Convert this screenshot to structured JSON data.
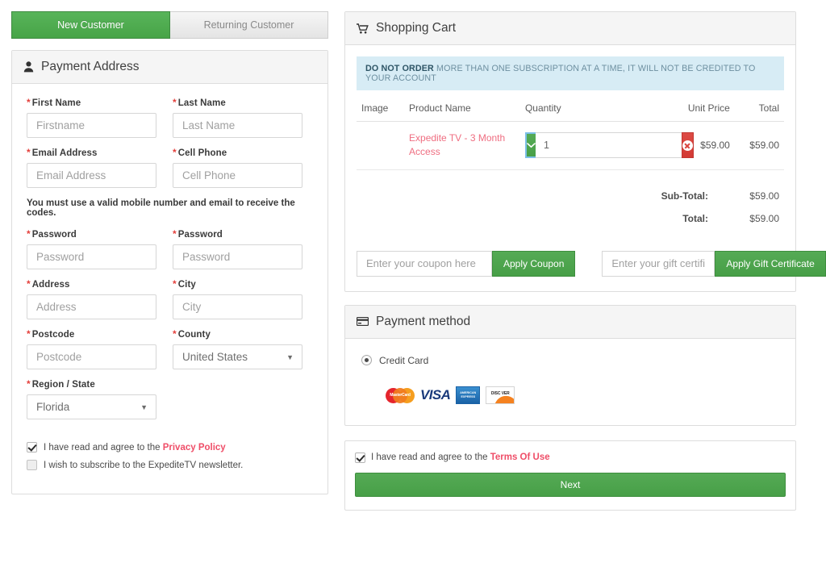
{
  "tabs": {
    "new_customer": "New Customer",
    "returning_customer": "Returning Customer"
  },
  "payment_address": {
    "title": "Payment Address",
    "icon": "user-icon",
    "required_marker": "*",
    "helper_text": "You must use a valid mobile number and email to receive the codes.",
    "fields": [
      {
        "label": "First Name",
        "placeholder": "Firstname",
        "value": "",
        "type": "text"
      },
      {
        "label": "Last Name",
        "placeholder": "Last Name",
        "value": "",
        "type": "text"
      },
      {
        "label": "Email Address",
        "placeholder": "Email Address",
        "value": "",
        "type": "text"
      },
      {
        "label": "Cell Phone",
        "placeholder": "Cell Phone",
        "value": "",
        "type": "text"
      },
      {
        "label": "Password",
        "placeholder": "Password",
        "value": "",
        "type": "password"
      },
      {
        "label": "Password",
        "placeholder": "Password",
        "value": "",
        "type": "password"
      },
      {
        "label": "Address",
        "placeholder": "Address",
        "value": "",
        "type": "text"
      },
      {
        "label": "City",
        "placeholder": "City",
        "value": "",
        "type": "text"
      },
      {
        "label": "Postcode",
        "placeholder": "Postcode",
        "value": "",
        "type": "text"
      },
      {
        "label": "County",
        "value": "United States",
        "type": "select"
      },
      {
        "label": "Region / State",
        "value": "Florida",
        "type": "select"
      }
    ],
    "consents": [
      {
        "text_before": "I have read and agree to the ",
        "link": "Privacy Policy",
        "checked": true
      },
      {
        "text_before": "I wish to subscribe to the ExpediteTV newsletter.",
        "link": "",
        "checked": false
      }
    ]
  },
  "cart": {
    "title": "Shopping Cart",
    "icon": "cart-icon",
    "alert_bold": "DO NOT ORDER",
    "alert_rest": " MORE THAN ONE SUBSCRIPTION AT A TIME, IT WILL NOT BE CREDITED TO YOUR ACCOUNT",
    "columns": [
      "Image",
      "Product Name",
      "Quantity",
      "Unit Price",
      "Total"
    ],
    "items": [
      {
        "product_name": "Expedite TV - 3 Month Access",
        "quantity": "1",
        "unit_price": "$59.00",
        "total": "$59.00",
        "decrement_icon": "chevron-down-icon",
        "remove_icon": "remove-circle-icon"
      }
    ],
    "totals": [
      {
        "label": "Sub-Total:",
        "value": "$59.00"
      },
      {
        "label": "Total:",
        "value": "$59.00"
      }
    ],
    "coupon": {
      "placeholder": "Enter your coupon here",
      "value": "",
      "button": "Apply Coupon"
    },
    "gift": {
      "placeholder": "Enter your gift certific",
      "value": "",
      "button": "Apply Gift Certificate"
    }
  },
  "payment_method": {
    "title": "Payment method",
    "icon": "credit-card-icon",
    "options": [
      {
        "label": "Credit Card",
        "selected": true
      }
    ],
    "cards": [
      {
        "name": "mastercard-logo",
        "text": "MasterCard"
      },
      {
        "name": "visa-logo",
        "text": "VISA"
      },
      {
        "name": "amex-logo",
        "text": "AMERICAN EXPRESS"
      },
      {
        "name": "discover-logo",
        "text": "DISC VER"
      }
    ]
  },
  "footer": {
    "terms_text_before": "I have read and agree to the ",
    "terms_link": "Terms Of Use",
    "terms_checked": true,
    "next_button": "Next"
  },
  "colors": {
    "brand_green": "#4fa64f",
    "link_pink": "#ef4e68",
    "danger_red": "#d9453f",
    "alert_blue_bg": "#d7ecf5",
    "required_red": "#e4403c"
  }
}
